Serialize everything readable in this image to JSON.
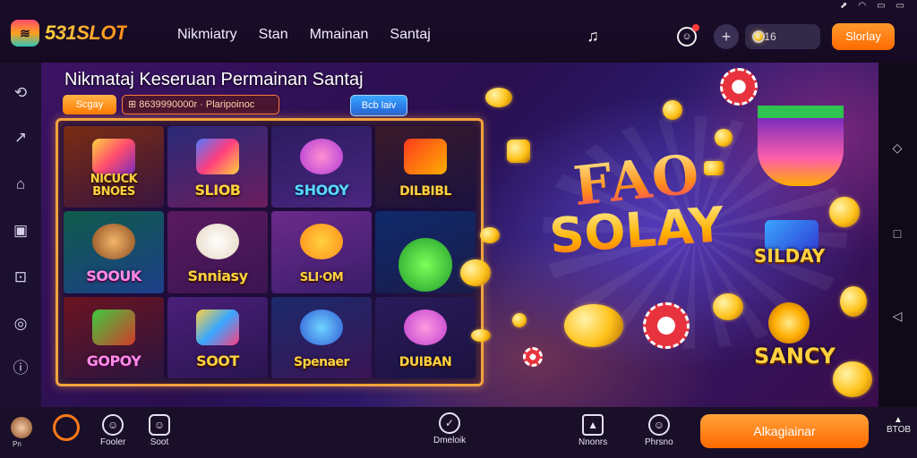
{
  "statusbar": {
    "icons": [
      "nav-arrow-icon",
      "wifi-icon",
      "battery-icon",
      "signal-icon"
    ],
    "glyphs": [
      "⬈",
      "◠",
      "▭",
      "▭"
    ]
  },
  "header": {
    "logo_text": "531SLOT",
    "logo_mark": "≋",
    "nav": [
      "Nikmiatry",
      "Stan",
      "Mmainan",
      "Santaj"
    ],
    "balance": "4416",
    "cta": "Slorlay"
  },
  "hero": {
    "title": "Nikmataj Keseruan Permainan Santaj",
    "pill_a": "Scgay",
    "pill_b": "⊞ 8639990000r · Plaripoinoc",
    "pill_c": "Bcb laiv",
    "tiles": [
      {
        "label": "NICUCK\nBNOES",
        "tone": "gold"
      },
      {
        "label": "SLIOB",
        "tone": "gold"
      },
      {
        "label": "SHOOY",
        "tone": "blue"
      },
      {
        "label": "DILBIBL",
        "tone": "gold"
      },
      {
        "label": "SOOUK",
        "tone": "pink"
      },
      {
        "label": "Snniasy",
        "tone": "gold"
      },
      {
        "label": "SLI·OM",
        "tone": "gold"
      },
      {
        "label": "",
        "tone": "gold"
      },
      {
        "label": "GOPOY",
        "tone": "pink"
      },
      {
        "label": "SOOT",
        "tone": "gold"
      },
      {
        "label": "Spenaer",
        "tone": "gold"
      },
      {
        "label": "DUIBAN",
        "tone": "gold"
      }
    ],
    "big_logo_line1": "FAO",
    "big_logo_line2": "SOLAY",
    "badge_a": "SILDAY",
    "badge_b": "SANCY"
  },
  "sidebar": {
    "icons": [
      "clock-icon",
      "share-icon",
      "home-icon",
      "image-icon",
      "gift-icon",
      "location-icon",
      "info-icon"
    ],
    "glyphs": [
      "⟲",
      "↗",
      "⌂",
      "▣",
      "⊡",
      "◎",
      "ⓘ"
    ]
  },
  "rail": {
    "icons": [
      "recent-icon",
      "home-square-icon",
      "back-icon"
    ],
    "glyphs": [
      "◇",
      "□",
      "◁"
    ]
  },
  "bottom": {
    "me_label": "Pn",
    "items": [
      {
        "label": "Fooler",
        "glyph": "☺"
      },
      {
        "label": "Soot",
        "glyph": "☺"
      },
      {
        "label": "Dmeloik",
        "glyph": "✓"
      },
      {
        "label": "Nnonrs",
        "glyph": "▲"
      },
      {
        "label": "Phrsno",
        "glyph": "☺"
      }
    ],
    "cta": "Alkagiainar",
    "top_label": "BTOB"
  }
}
